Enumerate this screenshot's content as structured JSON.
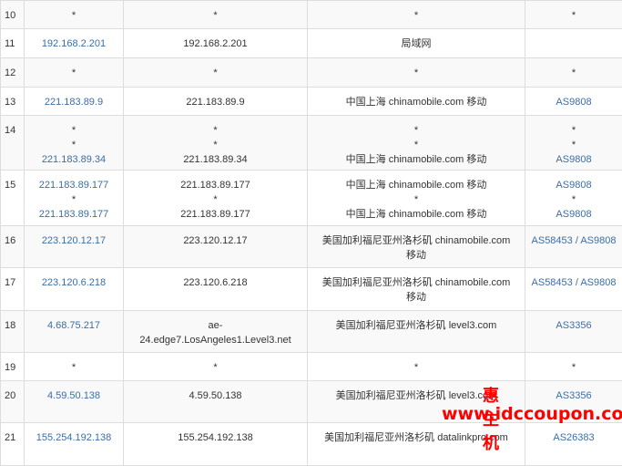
{
  "rows": [
    {
      "hop": "10",
      "ip": [
        "*"
      ],
      "host": [
        "*"
      ],
      "loc": [
        "*"
      ],
      "asn": [
        "*"
      ],
      "h": 31
    },
    {
      "hop": "11",
      "ip": [
        "192.168.2.201"
      ],
      "host": [
        "192.168.2.201"
      ],
      "loc": [
        "局域网"
      ],
      "asn": [],
      "h": 32
    },
    {
      "hop": "12",
      "ip": [
        "*"
      ],
      "host": [
        "*"
      ],
      "loc": [
        "*"
      ],
      "asn": [
        "*"
      ],
      "h": 32
    },
    {
      "hop": "13",
      "ip": [
        "221.183.89.9"
      ],
      "host": [
        "221.183.89.9"
      ],
      "loc": [
        "中国上海 chinamobile.com 移动"
      ],
      "asn": [
        "AS9808"
      ],
      "h": 31
    },
    {
      "hop": "14",
      "ip": [
        "*",
        "*",
        "221.183.89.34"
      ],
      "host": [
        "*",
        "*",
        "221.183.89.34"
      ],
      "loc": [
        "*",
        "*",
        "中国上海 chinamobile.com 移动"
      ],
      "asn": [
        "*",
        "*",
        "AS9808"
      ],
      "h": 60
    },
    {
      "hop": "15",
      "ip": [
        "221.183.89.177",
        "*",
        "221.183.89.177"
      ],
      "host": [
        "221.183.89.177",
        "*",
        "221.183.89.177"
      ],
      "loc": [
        "中国上海 chinamobile.com 移动",
        "*",
        "中国上海 chinamobile.com 移动"
      ],
      "asn": [
        "AS9808",
        "*",
        "AS9808"
      ],
      "h": 61
    },
    {
      "hop": "16",
      "ip": [
        "223.120.12.17"
      ],
      "host": [
        "223.120.12.17"
      ],
      "loc": [
        "美国加利福尼亚州洛杉矶 chinamobile.com",
        "移动"
      ],
      "asn": [
        "AS58453 / AS9808"
      ],
      "h": 46
    },
    {
      "hop": "17",
      "ip": [
        "223.120.6.218"
      ],
      "host": [
        "223.120.6.218"
      ],
      "loc": [
        "美国加利福尼亚州洛杉矶 chinamobile.com",
        "移动"
      ],
      "asn": [
        "AS58453 / AS9808"
      ],
      "h": 47
    },
    {
      "hop": "18",
      "ip": [
        "4.68.75.217"
      ],
      "host": [
        "ae-",
        "24.edge7.LosAngeles1.Level3.net"
      ],
      "loc": [
        "美国加利福尼亚州洛杉矶 level3.com"
      ],
      "asn": [
        "AS3356"
      ],
      "h": 46
    },
    {
      "hop": "19",
      "ip": [
        "*"
      ],
      "host": [
        "*"
      ],
      "loc": [
        "*"
      ],
      "asn": [
        "*"
      ],
      "h": 31
    },
    {
      "hop": "20",
      "ip": [
        "4.59.50.138"
      ],
      "host": [
        "4.59.50.138"
      ],
      "loc": [
        "美国加利福尼亚州洛杉矶 level3.com"
      ],
      "asn": [
        "AS3356"
      ],
      "h": 46
    },
    {
      "hop": "21",
      "ip": [
        "155.254.192.138"
      ],
      "host": [
        "155.254.192.138"
      ],
      "loc": [
        "美国加利福尼亚州洛杉矶 datalinkpro.com"
      ],
      "asn": [
        "AS26383"
      ],
      "h": 47
    }
  ],
  "watermark": {
    "brand": "惠主机",
    "url": "www.idccoupon.com"
  }
}
